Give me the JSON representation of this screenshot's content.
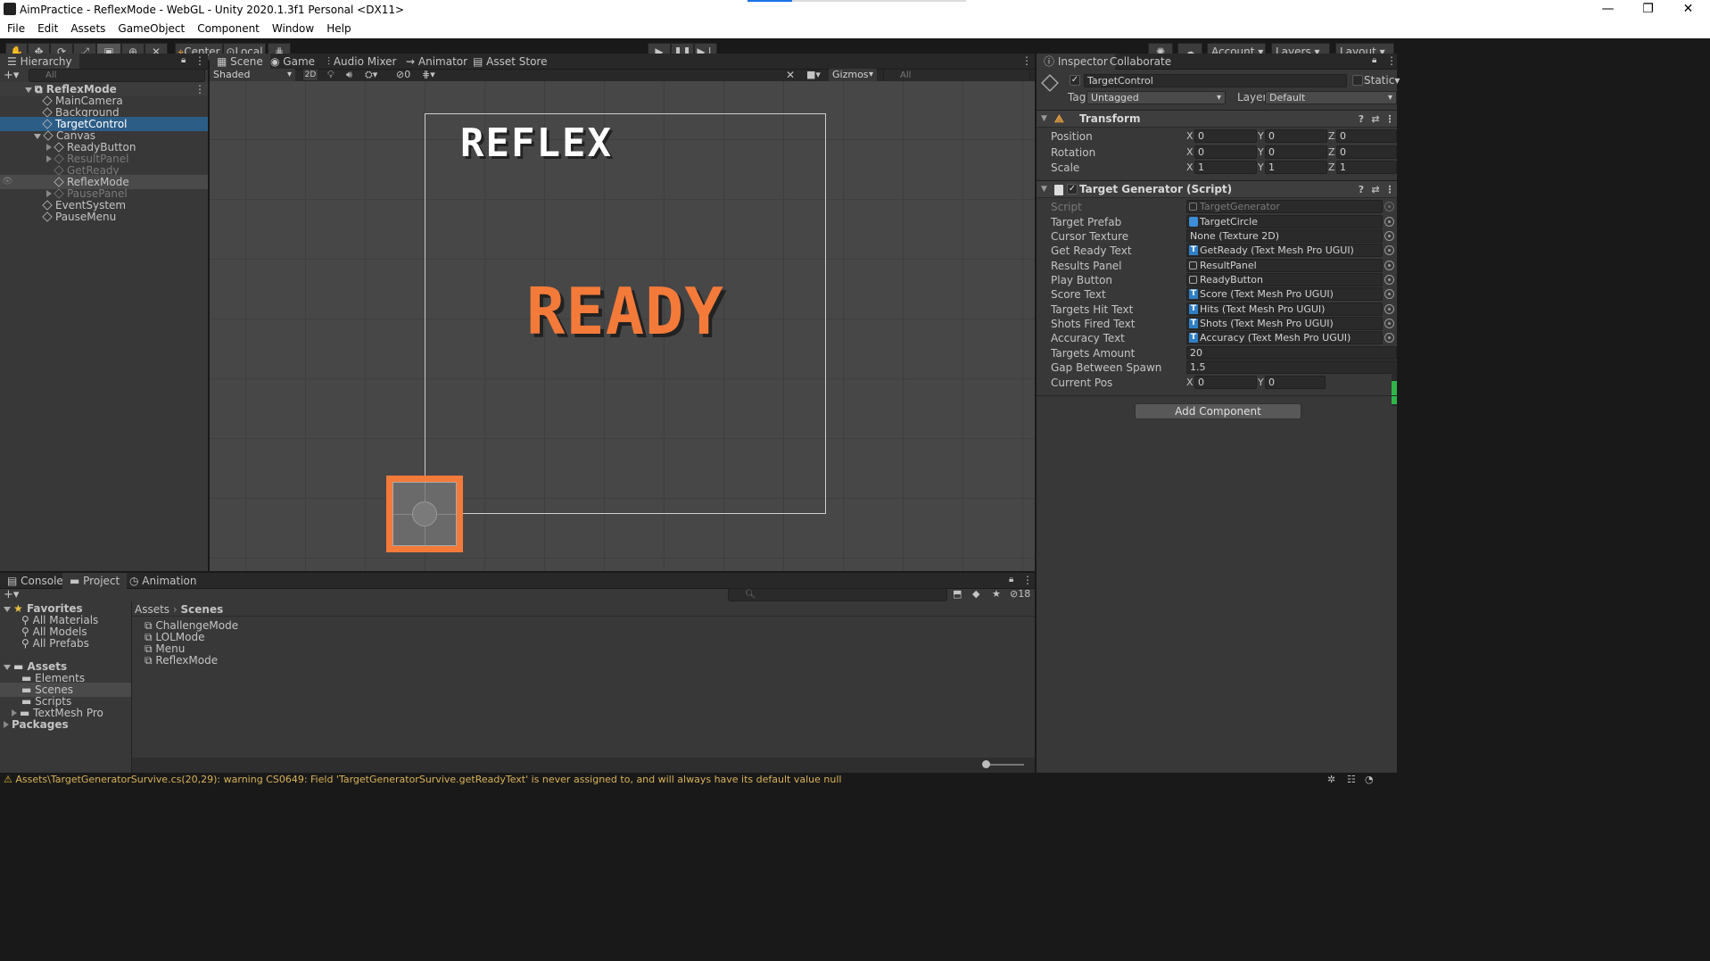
{
  "window": {
    "title": "AimPractice - ReflexMode - WebGL - Unity 2020.1.3f1 Personal <DX11>",
    "minimize": "—",
    "maximize": "❐",
    "close": "✕"
  },
  "menu": [
    "File",
    "Edit",
    "Assets",
    "GameObject",
    "Component",
    "Window",
    "Help"
  ],
  "toolbar": {
    "pivot": "Center",
    "space": "Local",
    "account": "Account",
    "layers": "Layers",
    "layout": "Layout"
  },
  "hierarchy": {
    "tab": "Hierarchy",
    "search_placeholder": "All",
    "add": "+▾",
    "scene": "ReflexMode",
    "items": [
      {
        "label": "MainCamera",
        "indent": 2
      },
      {
        "label": "Background",
        "indent": 2
      },
      {
        "label": "TargetControl",
        "indent": 2
      },
      {
        "label": "Canvas",
        "indent": 2
      },
      {
        "label": "ReadyButton",
        "indent": 3
      },
      {
        "label": "ResultPanel",
        "indent": 3
      },
      {
        "label": "GetReady",
        "indent": 3
      },
      {
        "label": "ReflexMode",
        "indent": 3
      },
      {
        "label": "PausePanel",
        "indent": 3
      },
      {
        "label": "EventSystem",
        "indent": 2
      },
      {
        "label": "PauseMenu",
        "indent": 2
      }
    ]
  },
  "scene_view": {
    "tabs": [
      "Scene",
      "Game",
      "Audio Mixer",
      "Animator",
      "Asset Store"
    ],
    "shading": "Shaded",
    "mode_2d": "2D",
    "hidden_count": "0",
    "gizmos": "Gizmos",
    "search_placeholder": "All",
    "title_text": "REFLEX",
    "ready_text": "READY"
  },
  "inspector": {
    "tabs": [
      "Inspector",
      "Collaborate"
    ],
    "object_name": "TargetControl",
    "static_label": "Static",
    "tag_label": "Tag",
    "tag_value": "Untagged",
    "layer_label": "Layer",
    "layer_value": "Default",
    "transform": {
      "title": "Transform",
      "position": {
        "label": "Position",
        "x": "0",
        "y": "0",
        "z": "0"
      },
      "rotation": {
        "label": "Rotation",
        "x": "0",
        "y": "0",
        "z": "0"
      },
      "scale": {
        "label": "Scale",
        "x": "1",
        "y": "1",
        "z": "1"
      }
    },
    "script_component": {
      "title": "Target Generator (Script)",
      "fields": [
        {
          "label": "Script",
          "value": "TargetGenerator",
          "kind": "script"
        },
        {
          "label": "Target Prefab",
          "value": "TargetCircle",
          "kind": "prefab"
        },
        {
          "label": "Cursor Texture",
          "value": "None (Texture 2D)",
          "kind": "none"
        },
        {
          "label": "Get Ready Text",
          "value": "GetReady (Text Mesh Pro UGUI)",
          "kind": "tmp"
        },
        {
          "label": "Results Panel",
          "value": "ResultPanel",
          "kind": "go"
        },
        {
          "label": "Play Button",
          "value": "ReadyButton",
          "kind": "go"
        },
        {
          "label": "Score Text",
          "value": "Score (Text Mesh Pro UGUI)",
          "kind": "tmp"
        },
        {
          "label": "Targets Hit Text",
          "value": "Hits (Text Mesh Pro UGUI)",
          "kind": "tmp"
        },
        {
          "label": "Shots Fired Text",
          "value": "Shots (Text Mesh Pro UGUI)",
          "kind": "tmp"
        },
        {
          "label": "Accuracy Text",
          "value": "Accuracy (Text Mesh Pro UGUI)",
          "kind": "tmp"
        }
      ],
      "targets_amount": {
        "label": "Targets Amount",
        "value": "20"
      },
      "gap_between_spawn": {
        "label": "Gap Between Spawn",
        "value": "1.5"
      },
      "current_pos": {
        "label": "Current Pos",
        "x": "0",
        "y": "0"
      }
    },
    "add_component": "Add Component"
  },
  "bottom": {
    "tabs": [
      "Console",
      "Project",
      "Animation"
    ],
    "hidden_count": "18",
    "favorites": {
      "label": "Favorites",
      "items": [
        "All Materials",
        "All Models",
        "All Prefabs"
      ]
    },
    "assets": {
      "label": "Assets",
      "items": [
        "Elements",
        "Scenes",
        "Scripts",
        "TextMesh Pro"
      ]
    },
    "packages": "Packages",
    "breadcrumb": [
      "Assets",
      "Scenes"
    ],
    "files": [
      "ChallengeMode",
      "LOLMode",
      "Menu",
      "ReflexMode"
    ]
  },
  "status": {
    "message": "Assets\\TargetGeneratorSurvive.cs(20,29): warning CS0649: Field 'TargetGeneratorSurvive.getReadyText' is never assigned to, and will always have its default value null"
  },
  "colors": {
    "accent": "#2c5d87",
    "ready_orange": "#f47a3a",
    "warning": "#d9b25a"
  }
}
